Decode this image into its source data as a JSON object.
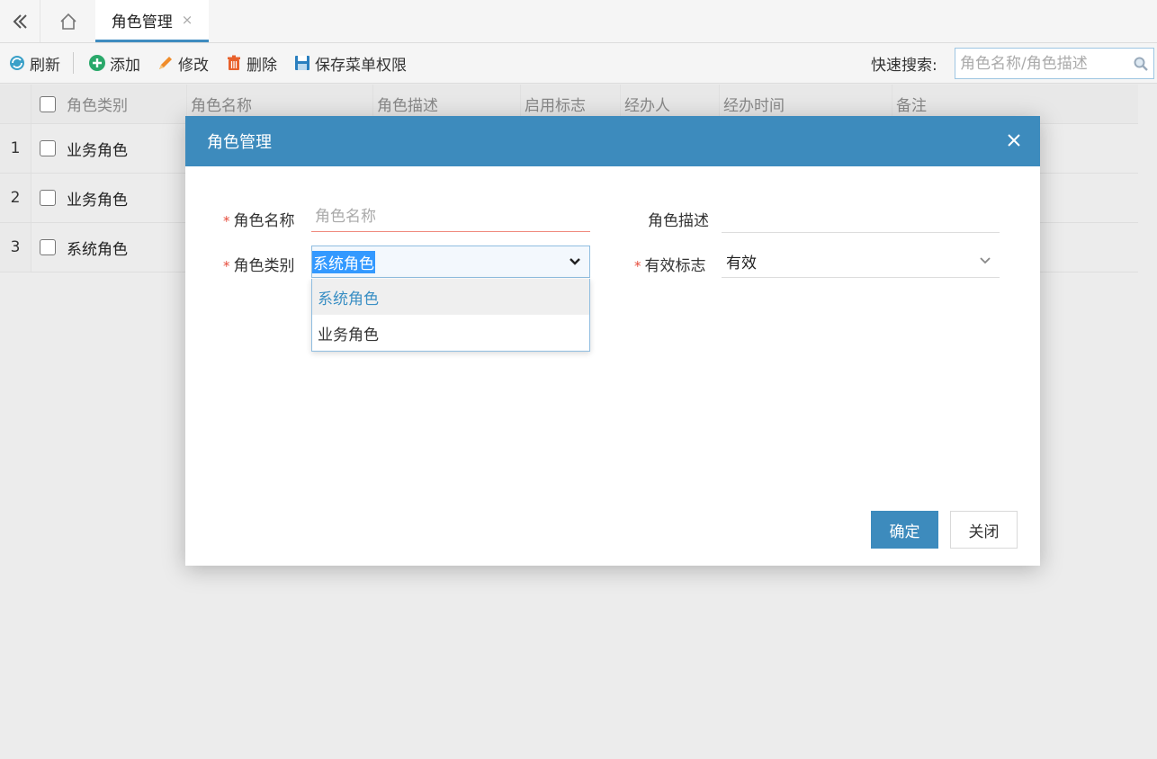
{
  "tabs": {
    "active_tab_label": "角色管理",
    "close_glyph": "×"
  },
  "toolbar": {
    "refresh_label": "刷新",
    "add_label": "添加",
    "edit_label": "修改",
    "delete_label": "删除",
    "save_menu_perm_label": "保存菜单权限",
    "search_label": "快速搜索:",
    "search_placeholder": "角色名称/角色描述"
  },
  "grid": {
    "columns": [
      "角色类别",
      "角色名称",
      "角色描述",
      "启用标志",
      "经办人",
      "经办时间",
      "备注"
    ],
    "rows": [
      {
        "num": "1",
        "type": "业务角色"
      },
      {
        "num": "2",
        "type": "业务角色"
      },
      {
        "num": "3",
        "type": "系统角色"
      }
    ]
  },
  "dialog": {
    "title": "角色管理",
    "role_name_label": "角色名称",
    "role_name_placeholder": "角色名称",
    "role_desc_label": "角色描述",
    "role_type_label": "角色类别",
    "role_type_value": "系统角色",
    "role_type_options": [
      "系统角色",
      "业务角色"
    ],
    "valid_flag_label": "有效标志",
    "valid_flag_value": "有效",
    "required_mark": "*",
    "ok_label": "确定",
    "close_label": "关闭"
  },
  "colors": {
    "accent": "#3d8bbd",
    "required": "#e64c3c",
    "selection": "#3399ff"
  }
}
